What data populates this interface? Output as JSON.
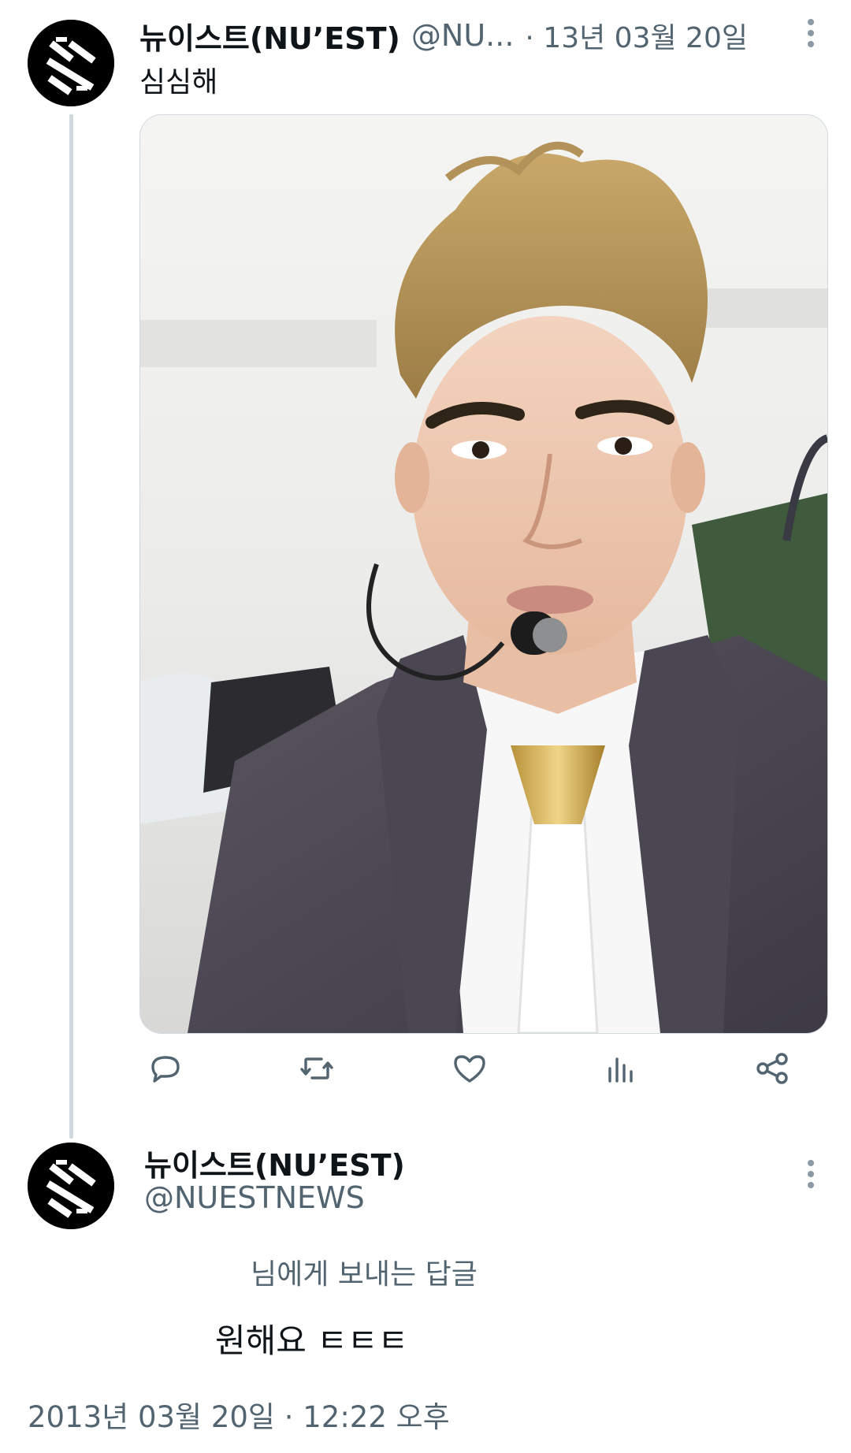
{
  "tweet": {
    "author_name": "뉴이스트(NU’EST)",
    "author_handle": "@NU...",
    "date": "· 13년 03월 20일",
    "text": "심심해"
  },
  "actions": [
    "reply-icon",
    "retweet-icon",
    "like-icon",
    "views-icon",
    "share-icon"
  ],
  "reply": {
    "author_name": "뉴이스트(NU’EST)",
    "author_handle": "@NUESTNEWS",
    "replying_to": "님에게 보내는 답글",
    "text": "원해요 ㅌㅌㅌ",
    "timestamp": "2013년 03월 20일 · 12:22 오후"
  },
  "colors": {
    "text_primary": "#0f1419",
    "text_secondary": "#536471",
    "border": "#cfd9de"
  }
}
